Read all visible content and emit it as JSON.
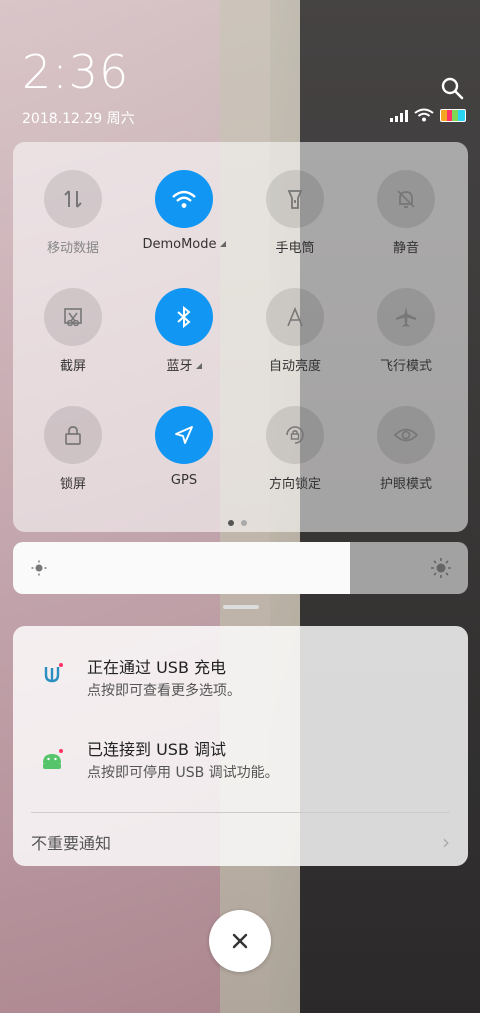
{
  "status": {
    "time": "2:36",
    "date": "2018.12.29 周六",
    "battery_colors": [
      "#f4a623",
      "#ff3366",
      "#7ed957",
      "#2bd4f5"
    ]
  },
  "accent_color": "#1296f3",
  "quick_settings": {
    "tiles": [
      {
        "label": "移动数据",
        "icon": "mobile-data-icon",
        "active": false,
        "dimmed": true
      },
      {
        "label": "DemoMode",
        "icon": "wifi-icon",
        "active": true,
        "expandable": true
      },
      {
        "label": "手电筒",
        "icon": "flashlight-icon",
        "active": false
      },
      {
        "label": "静音",
        "icon": "bell-off-icon",
        "active": false
      },
      {
        "label": "截屏",
        "icon": "screenshot-icon",
        "active": false
      },
      {
        "label": "蓝牙",
        "icon": "bluetooth-icon",
        "active": true,
        "expandable": true
      },
      {
        "label": "自动亮度",
        "icon": "auto-brightness-icon",
        "active": false
      },
      {
        "label": "飞行模式",
        "icon": "airplane-icon",
        "active": false
      },
      {
        "label": "锁屏",
        "icon": "lock-icon",
        "active": false
      },
      {
        "label": "GPS",
        "icon": "gps-icon",
        "active": true
      },
      {
        "label": "方向锁定",
        "icon": "rotation-lock-icon",
        "active": false
      },
      {
        "label": "护眼模式",
        "icon": "eye-icon",
        "active": false
      }
    ],
    "page_count": 2,
    "current_page": 1
  },
  "brightness": {
    "level": 0.74
  },
  "notifications": {
    "items": [
      {
        "title": "正在通过 USB 充电",
        "subtitle": "点按即可查看更多选项。",
        "icon": "usb-icon"
      },
      {
        "title": "已连接到 USB 调试",
        "subtitle": "点按即可停用 USB 调试功能。",
        "icon": "android-debug-icon"
      }
    ],
    "unimportant_label": "不重要通知"
  }
}
